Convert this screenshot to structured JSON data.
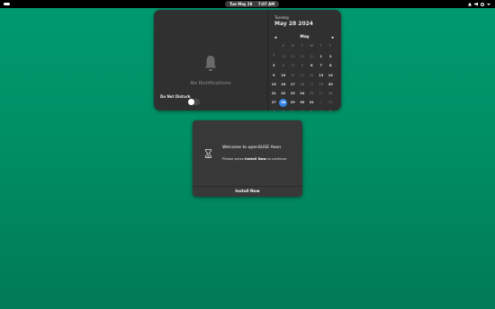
{
  "topbar": {
    "date": "Tue May 28",
    "time": "7:07 AM",
    "icons": [
      "activities-indicator",
      "network-icon",
      "volume-icon",
      "power-icon",
      "system-menu-chevron-icon"
    ]
  },
  "notifications": {
    "empty_text": "No Notifications",
    "dnd_label": "Do Not Disturb",
    "dnd_enabled": false,
    "icon": "bell-icon"
  },
  "calendar": {
    "weekday": "Tuesday",
    "full_date": "May 28 2024",
    "month": "May",
    "prev_icon": "◂",
    "next_icon": "▸",
    "headers": [
      "S",
      "M",
      "T",
      "W",
      "T",
      "F",
      "S"
    ],
    "rows": [
      {
        "week": "18",
        "days": [
          "28",
          "29",
          "30",
          "1",
          "2",
          "3",
          "4"
        ]
      },
      {
        "week": "19",
        "days": [
          "5",
          "6",
          "7",
          "8",
          "9",
          "10",
          "11"
        ]
      },
      {
        "week": "20",
        "days": [
          "12",
          "13",
          "14",
          "15",
          "16",
          "17",
          "18"
        ]
      },
      {
        "week": "21",
        "days": [
          "19",
          "20",
          "21",
          "22",
          "23",
          "24",
          "25"
        ]
      },
      {
        "week": "22",
        "days": [
          "26",
          "27",
          "28",
          "29",
          "30",
          "31",
          "1"
        ]
      },
      {
        "week": "23",
        "days": [
          "2",
          "3",
          "4",
          "5",
          "6",
          "7",
          "8"
        ]
      }
    ],
    "today": "28",
    "accent": "#3584e4"
  },
  "dialog": {
    "title": "Welcome to openSUSE Aeon",
    "body_prefix": "Please press ",
    "body_bold": "Install Now",
    "body_suffix": " to continue",
    "button": "Install Now",
    "icon": "hourglass-icon"
  },
  "colors": {
    "desktop": "#008f65",
    "panel": "#303030",
    "dialog": "#383838"
  }
}
